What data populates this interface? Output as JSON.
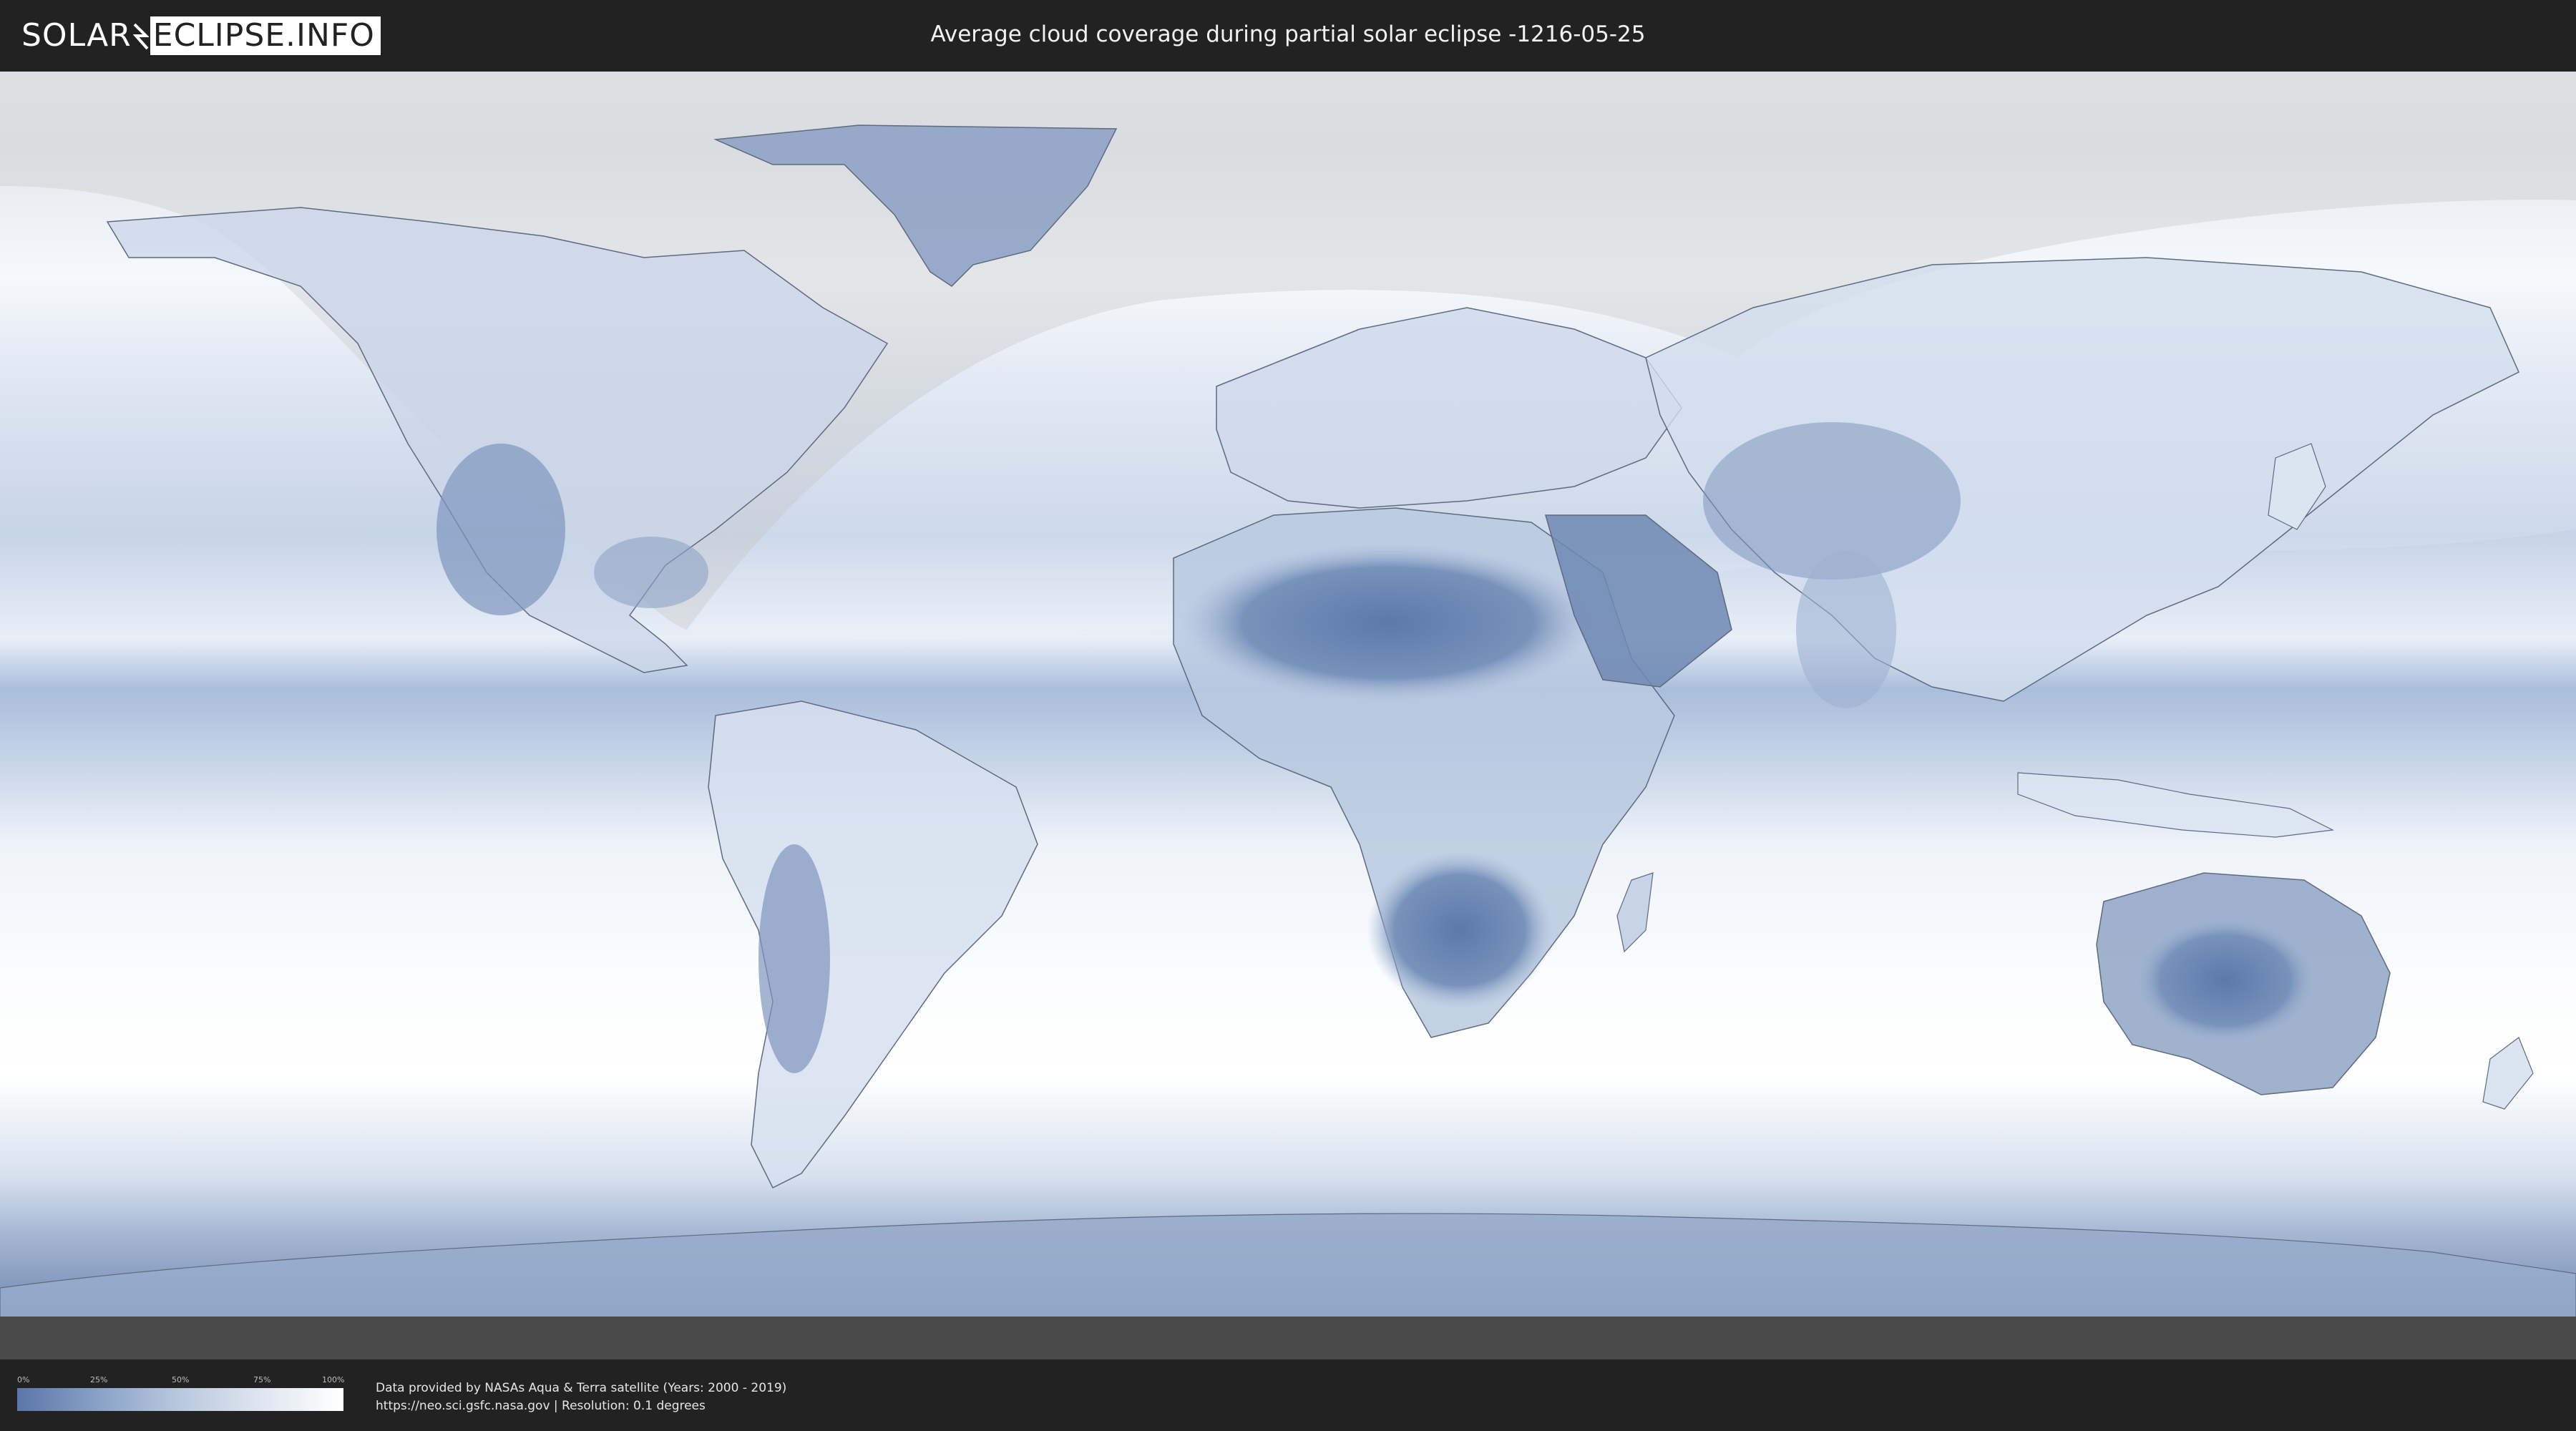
{
  "header": {
    "logo_left": "SOLAR",
    "logo_right": "ECLIPSE.INFO",
    "title": "Average cloud coverage during partial solar eclipse -1216-05-25"
  },
  "map": {
    "kind": "world cloud coverage map",
    "projection": "equirectangular",
    "eclipse_type": "partial",
    "colors": {
      "clear_sky": "#5b77a8",
      "full_cloud": "#ffffff",
      "land_outline": "#5d6a80",
      "eclipse_zone": "#ffffff",
      "night_zone": "#b0b0b0"
    }
  },
  "legend": {
    "ticks": [
      "0%",
      "25%",
      "50%",
      "75%",
      "100%"
    ],
    "gradient_start": "#5b77a8",
    "gradient_end": "#ffffff"
  },
  "footer": {
    "line1": "Data provided by NASAs Aqua & Terra satellite (Years: 2000 - 2019)",
    "line2": "https://neo.sci.gsfc.nasa.gov | Resolution: 0.1 degrees"
  }
}
